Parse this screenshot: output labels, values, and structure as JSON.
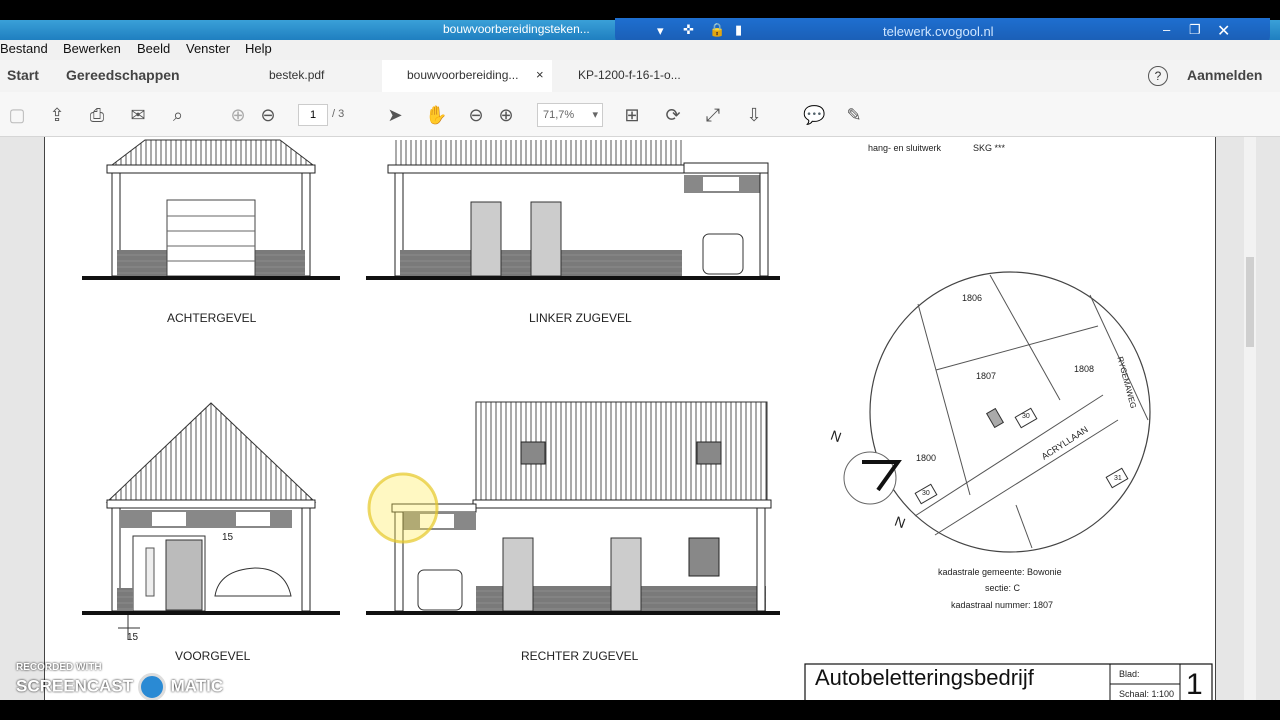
{
  "window": {
    "title": "bouwvoorbereidingsteken...",
    "remote_host": "telewerk.cvogool.nl"
  },
  "menu": [
    "Bestand",
    "Bewerken",
    "Beeld",
    "Venster",
    "Help"
  ],
  "tabs": {
    "start": "Start",
    "tools": "Gereedschappen",
    "doc1": "bestek.pdf",
    "doc2": "bouwvoorbereiding...",
    "doc3": "KP-1200-f-16-1-o...",
    "signin": "Aanmelden",
    "close_glyph": "×",
    "help_glyph": "?"
  },
  "toolbar": {
    "page_current": "1",
    "page_total": "/ 3",
    "zoom": "71,7%"
  },
  "drawing": {
    "labels": {
      "achtergevel": "ACHTERGEVEL",
      "linker": "LINKER ZUGEVEL",
      "voorgevel": "VOORGEVEL",
      "rechter": "RECHTER ZUGEVEL"
    },
    "spec": [
      "hang- en sluitwerk",
      "SKG ***"
    ],
    "site": {
      "parcels": [
        "1806",
        "1807",
        "1808",
        "1800"
      ],
      "house_numbers": [
        "30",
        "30",
        "31"
      ],
      "street1": "ACRYLLAAN",
      "street2": "RYGEMAWEG",
      "north": "N",
      "north2": "N"
    },
    "cadastral": [
      "kadastrale gemeente: Bowonie",
      "sectie: C",
      "kadastraal nummer: 1807"
    ],
    "titleblock": {
      "title": "Autobeletteringsbedrijf",
      "blad_label": "Blad:",
      "schaal_label": "Schaal: 1:100",
      "number": "1"
    },
    "marker_small": "15",
    "marker_small2": "15"
  },
  "watermark": {
    "line1": "RECORDED WITH",
    "line2": "SCREENCAST",
    "line3": "MATIC"
  }
}
